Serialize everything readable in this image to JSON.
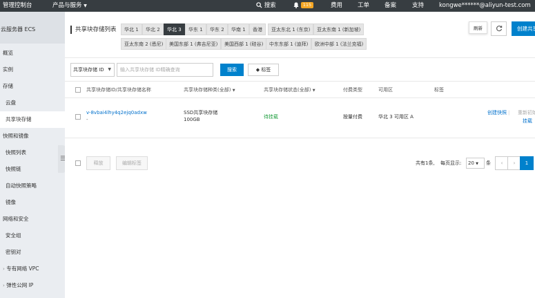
{
  "topbar": {
    "console": "管理控制台",
    "products": "产品与服务",
    "search": "搜索",
    "notif_count": "115",
    "billing": "费用",
    "ticket": "工单",
    "icp": "备案",
    "support": "支持",
    "user": "kongwe******@aliyun-test.com"
  },
  "sidebar": {
    "title": "云服务器 ECS",
    "items": [
      {
        "label": "概览"
      },
      {
        "label": "实例"
      },
      {
        "label": "存储"
      },
      {
        "label": "云盘"
      },
      {
        "label": "共享块存储"
      },
      {
        "label": "快照和镜像"
      },
      {
        "label": "快照列表"
      },
      {
        "label": "快照链"
      },
      {
        "label": "自动快照策略"
      },
      {
        "label": "镜像"
      },
      {
        "label": "网络和安全"
      },
      {
        "label": "安全组"
      },
      {
        "label": "密钥对"
      },
      {
        "label": "专有网络 VPC"
      },
      {
        "label": "弹性公网 IP"
      }
    ],
    "collapse_icon": "☰"
  },
  "main": {
    "title": "共享块存储列表",
    "regions_row1": [
      "华北 1",
      "华北 2",
      "华北 3",
      "华东 1",
      "华东 2",
      "华南 1",
      "香港",
      "亚太东北 1 (东京)",
      "亚太东南 1 (新加坡)"
    ],
    "regions_row2": [
      "亚太东南 2 (悉尼)",
      "美国东部 1 (弗吉尼亚)",
      "美国西部 1 (硅谷)",
      "中东东部 1 (迪拜)",
      "欧洲中部 1 (法兰克福)"
    ],
    "selected_region": "华北 3",
    "refresh_tooltip": "刷新",
    "create_button": "创建共享块存储",
    "filter": {
      "select_value": "共享块存储 ID",
      "placeholder": "输入共享块存储 ID精确查询",
      "search_button": "搜索",
      "tag_button": "标签"
    },
    "table": {
      "headers": {
        "id_name": "共享块存储ID/共享块存储名称",
        "type": "共享块存储种类(全部)",
        "status": "共享块存储状态(全部)",
        "billing": "付费类型",
        "zone": "可用区",
        "tags": "标签"
      },
      "row": {
        "id": "v-8vbai4lhy4q2ejq0adxw",
        "name": "-",
        "type": "SSD共享块存储",
        "size": "100GB",
        "status": "待挂载",
        "billing": "按量付费",
        "zone": "华北 3 可用区 A",
        "action_snapshot": "创建快照",
        "action_reinit": "重新初始化",
        "action_mount": "挂载"
      }
    },
    "footer": {
      "release": "释放",
      "edit_tags": "编辑标签",
      "total": "共有1条,",
      "per_page_label": "每页显示:",
      "page_size": "20",
      "per_page_unit": "条",
      "prev": "‹",
      "next": "›",
      "current_page": "1"
    }
  },
  "colors": {
    "topbar_bg": "#373d41",
    "accent": "#0081cc",
    "sidebar_bg": "#eaedf1",
    "badge": "#f5a623",
    "status_green": "#1e9e3e"
  }
}
